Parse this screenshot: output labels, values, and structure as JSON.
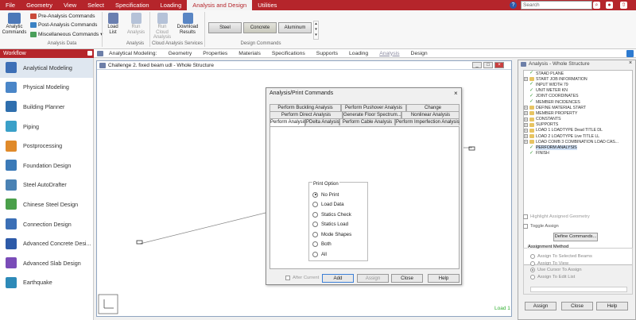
{
  "menubar": {
    "tabs": [
      "File",
      "Geometry",
      "View",
      "Select",
      "Specification",
      "Loading",
      "Analysis and Design",
      "Utilities"
    ],
    "active": "Analysis and Design",
    "search_placeholder": "Search"
  },
  "ribbon": {
    "analytic_commands": "Analytic Commands",
    "pre_analysis": "Pre-Analysis Commands",
    "post_analysis": "Post-Analysis Commands",
    "misc_commands": "Miscellaneous Commands",
    "load_list": "Load List",
    "run_analysis": "Run Analysis",
    "analysis_data": "Analysis Data",
    "analysis": "Analysis",
    "run_cloud": "Run Cloud Analysis",
    "download_results": "Download Results",
    "cloud_services": "Cloud Analysis Services",
    "design_steel": "Steel",
    "design_concrete": "Concrete",
    "design_aluminum": "Aluminum",
    "design_commands": "Design Commands"
  },
  "workflow": {
    "title": "Workflow",
    "items": [
      "Analytical Modeling",
      "Physical Modeling",
      "Building Planner",
      "Piping",
      "Postprocessing",
      "Foundation Design",
      "Steel AutoDrafter",
      "Chinese Steel Design",
      "Connection Design",
      "Advanced Concrete Desi...",
      "Advanced Slab Design",
      "Earthquake"
    ]
  },
  "page_tabs": {
    "label": "Analytical Modeling:",
    "tabs": [
      "Geometry",
      "Properties",
      "Materials",
      "Specifications",
      "Supports",
      "Loading",
      "Analysis",
      "Design"
    ],
    "active": "Analysis"
  },
  "viewport": {
    "title": "Challenge 2. fixed beam udl - Whole Structure",
    "load_label": "Load 1"
  },
  "dialog": {
    "title": "Analysis/Print Commands",
    "tabs_row1": [
      "Perform Buckling Analysis",
      "Perform Pushover Analysis",
      "Change"
    ],
    "tabs_row2": [
      "Perform Direct Analysis",
      "Generate Floor Spectrum...",
      "Nonlinear Analysis"
    ],
    "tabs_row3": [
      "Perform Analysis",
      "PDelta Analysis",
      "Perform Cable Analysis",
      "Perform Imperfection Analysis"
    ],
    "print_option_label": "Print Option",
    "options": [
      "No Print",
      "Load Data",
      "Statics Check",
      "Statics Load",
      "Mode Shapes",
      "Both",
      "All"
    ],
    "selected": "No Print",
    "after_current": "After Current",
    "add": "Add",
    "assign": "Assign",
    "close": "Close",
    "help": "Help"
  },
  "right_panel": {
    "title": "Analysis - Whole Structure",
    "tree": [
      {
        "label": "STAAD PLANE",
        "type": "check",
        "exp": ""
      },
      {
        "label": "START JOB INFORMATION",
        "type": "folder",
        "exp": "+"
      },
      {
        "label": "INPUT WIDTH 79",
        "type": "check",
        "exp": ""
      },
      {
        "label": "UNIT METER KN",
        "type": "check",
        "exp": ""
      },
      {
        "label": "JOINT COORDINATES",
        "type": "check",
        "exp": ""
      },
      {
        "label": "MEMBER INCIDENCES",
        "type": "check",
        "exp": ""
      },
      {
        "label": "DEFINE MATERIAL START",
        "type": "folder",
        "exp": "+"
      },
      {
        "label": "MEMBER PROPERTY",
        "type": "folder",
        "exp": "+"
      },
      {
        "label": "CONSTANTS",
        "type": "folder",
        "exp": "+"
      },
      {
        "label": "SUPPORTS",
        "type": "folder",
        "exp": "+"
      },
      {
        "label": "LOAD 1 LOADTYPE Dead  TITLE DL",
        "type": "folder",
        "exp": "+"
      },
      {
        "label": "LOAD 2 LOADTYPE Live  TITLE LL",
        "type": "folder",
        "exp": "+"
      },
      {
        "label": "LOAD COMB 3 COMBINATION LOAD CAS...",
        "type": "folder",
        "exp": "+"
      },
      {
        "label": "PERFORM ANALYSIS",
        "type": "check",
        "exp": "",
        "sel": true
      },
      {
        "label": "FINISH",
        "type": "check",
        "exp": ""
      }
    ],
    "highlight": "Highlight Assigned Geometry",
    "toggle": "Toggle Assign",
    "define_commands": "Define Commands...",
    "assignment_method": "Assignment Method",
    "methods": [
      "Assign To Selected Beams",
      "Assign To View",
      "Use Cursor To Assign",
      "Assign To Edit List"
    ],
    "assign": "Assign",
    "close": "Close",
    "help": "Help"
  },
  "colors": {
    "brand": "#b5252b",
    "folder": "#e7c462",
    "check": "#3a9f3a"
  }
}
